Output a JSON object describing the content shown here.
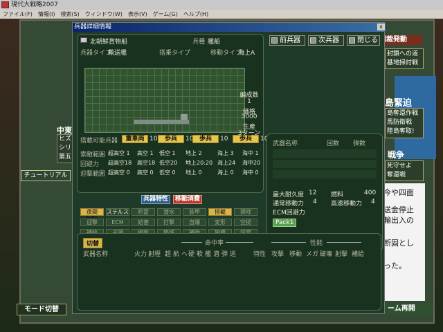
{
  "window": {
    "title": "現代大戦略2007"
  },
  "menu": [
    "ファイル(F)",
    "情報(I)",
    "検索(S)",
    "ウィンドウ(W)",
    "表示(V)",
    "ゲーム(G)",
    "ヘルプ(H)"
  ],
  "background": {
    "china_label": "中東",
    "left_info": [
      "ヒズ",
      "シリ",
      "第五"
    ],
    "tutorial_label": "チュートリアル",
    "mode_switch_label": "モード切替",
    "right_top_label": "制裁発動",
    "blockade_box": [
      "封鎖への道",
      "基地掃討戦"
    ],
    "island_label": "島緊迫",
    "island_box": [
      "島奪還作戦",
      "馬防衛戦",
      "陸島奪取!"
    ],
    "war_label": "戦争",
    "war_box": [
      "死守せよ",
      "奪還戦"
    ],
    "white_text": [
      "今や四面",
      "送金停止",
      "輸出入の",
      "断固とし",
      "った。"
    ],
    "resume_label": "ーム再開"
  },
  "dialog": {
    "title": "兵器詳細情報",
    "close": "x",
    "unit_name": "北朝鮮貨物船",
    "type_label": "兵種",
    "type_value": "艦船",
    "weapon_type_label": "兵器タイプ",
    "weapon_type_value": "輸送艦",
    "board_type_label": "搭乗タイプ",
    "move_type_label": "移動タイプ",
    "move_type_value": "海上A",
    "buttons": {
      "prev": "前兵器",
      "next": "次兵器",
      "close": "閉じる"
    },
    "stats": {
      "formation_label": "編成数",
      "formation_value": "1",
      "price_label": "価格",
      "price_value": "3000",
      "produce_label": "生産",
      "produce_value": "3ターン"
    },
    "carry_label": "搭載可能兵器",
    "carry_slots": [
      {
        "name": "重車両",
        "val": "10"
      },
      {
        "name": "歩兵",
        "val": "10"
      },
      {
        "name": "歩兵",
        "val": "10"
      },
      {
        "name": "歩兵",
        "val": "10"
      }
    ],
    "ranges": [
      {
        "label": "索敵範囲",
        "cells": [
          "超高空 1",
          "高空 1",
          "低空 1",
          "地上 2",
          "海上 3",
          "海中 1"
        ]
      },
      {
        "label": "回避力",
        "cells": [
          "超高空18",
          "高空18",
          "低空20",
          "地上20:20",
          "海上24",
          "海中20"
        ]
      },
      {
        "label": "迎撃範囲",
        "cells": [
          "超高空 0",
          "高空 0",
          "低空 0",
          "地上 0",
          "海上 0",
          "海中 0"
        ]
      }
    ],
    "tab_features": "兵器特性",
    "tab_move": "移動消費",
    "chips": [
      [
        "夜間50%",
        "ステルス",
        "防雷",
        "潜水",
        "装甲",
        "搭載",
        "掃除"
      ],
      [
        "迎撃",
        "ECM",
        "妨害",
        "打撃",
        "自爆",
        "変形",
        "空挺"
      ],
      [
        "補給",
        "占領",
        "修復",
        "築城",
        "補強",
        "架橋",
        "設営"
      ],
      [
        "道路",
        "地雷除去",
        "掃海",
        "被補給",
        "被補給",
        "被補給"
      ]
    ],
    "weapon_header": {
      "name": "武器名称",
      "count": "回数",
      "ammo": "弾数"
    },
    "durability_label": "最大耐久度",
    "durability_value": "12",
    "fuel_label": "燃料",
    "fuel_value": "400",
    "normal_move_label": "通常移動力",
    "normal_move_value": "4",
    "fast_move_label": "高速移動力",
    "fast_move_value": "4",
    "ecm_label": "ECM回避力",
    "pack_label": "Pack1",
    "switch_label": "切替",
    "bottom_header": {
      "name": "武器名称",
      "hit": "命中率",
      "perf": "性能"
    },
    "bottom_cols": [
      "火力",
      "射程",
      "超",
      "航",
      "ヘ",
      "硬",
      "軟",
      "艦",
      "潜",
      "弾",
      "巡",
      "特性",
      "攻撃",
      "移動",
      "メガ",
      "破壊",
      "射撃",
      "補給"
    ]
  }
}
